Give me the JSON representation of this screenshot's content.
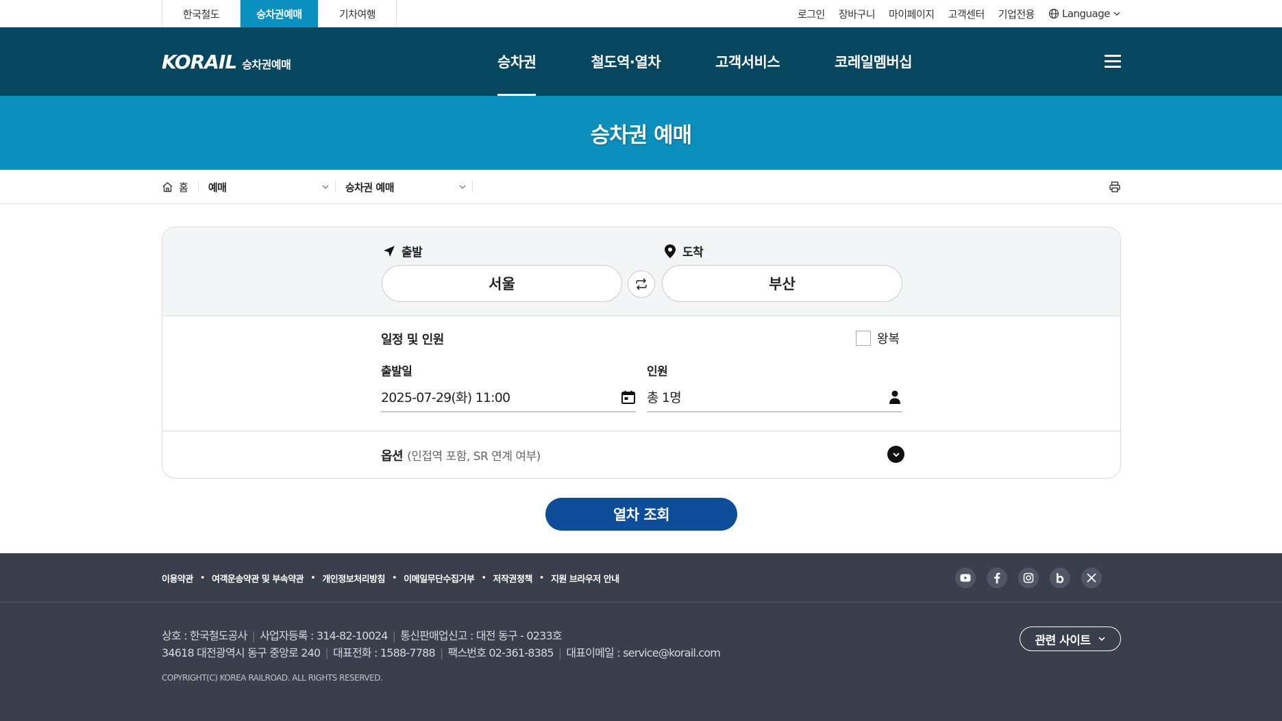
{
  "utility_bar": {
    "site_tabs": [
      "한국철도",
      "승차권예매",
      "기차여행"
    ],
    "links": [
      "로그인",
      "장바구니",
      "마이페이지",
      "고객센터",
      "기업전용"
    ],
    "language_label": "Language"
  },
  "header": {
    "logo_main": "KORAIL",
    "logo_sub": "승차권예매",
    "menu": [
      "승차권",
      "철도역·열차",
      "고객서비스",
      "코레일멤버십"
    ]
  },
  "banner": {
    "title": "승차권 예매"
  },
  "breadcrumb": {
    "home_label": "홈",
    "level1": "예매",
    "level2": "승차권 예매"
  },
  "booking": {
    "departure_label": "출발",
    "departure_value": "서울",
    "arrival_label": "도착",
    "arrival_value": "부산",
    "schedule_title": "일정 및 인원",
    "roundtrip_label": "왕복",
    "date_label": "출발일",
    "date_value": "2025-07-29(화) 11:00",
    "passengers_label": "인원",
    "passengers_value": "총 1명",
    "options_label": "옵션",
    "options_sub": "(인접역 포함, SR 연계 여부)",
    "search_button": "열차 조회"
  },
  "footer": {
    "links": [
      "이용약관",
      "여객운송약관 및 부속약관",
      "개인정보처리방침",
      "이메일무단수집거부",
      "저작권정책",
      "지원 브라우저 안내"
    ],
    "info_line1": [
      "상호 : 한국철도공사",
      "사업자등록 : 314-82-10024",
      "통신판매업신고 : 대전 동구 - 0233호"
    ],
    "info_line2": [
      "34618 대전광역시 동구 중앙로 240",
      "대표전화 : 1588-7788",
      "팩스번호 02-361-8385",
      "대표이메일 : service@korail.com"
    ],
    "copyright": "COPYRIGHT(C) KOREA RAILROAD. ALL RIGHTS RESERVED.",
    "related_sites": "관련 사이트",
    "sns_icons": [
      "youtube-icon",
      "facebook-icon",
      "instagram-icon",
      "blog-icon",
      "x-icon"
    ]
  },
  "colors": {
    "header_bg": "#06465f",
    "banner_bg": "#0b8fbc",
    "active_tab": "#0b8fc1",
    "search_button": "#0d4d9a",
    "footer_bg": "#3a3f4b"
  }
}
